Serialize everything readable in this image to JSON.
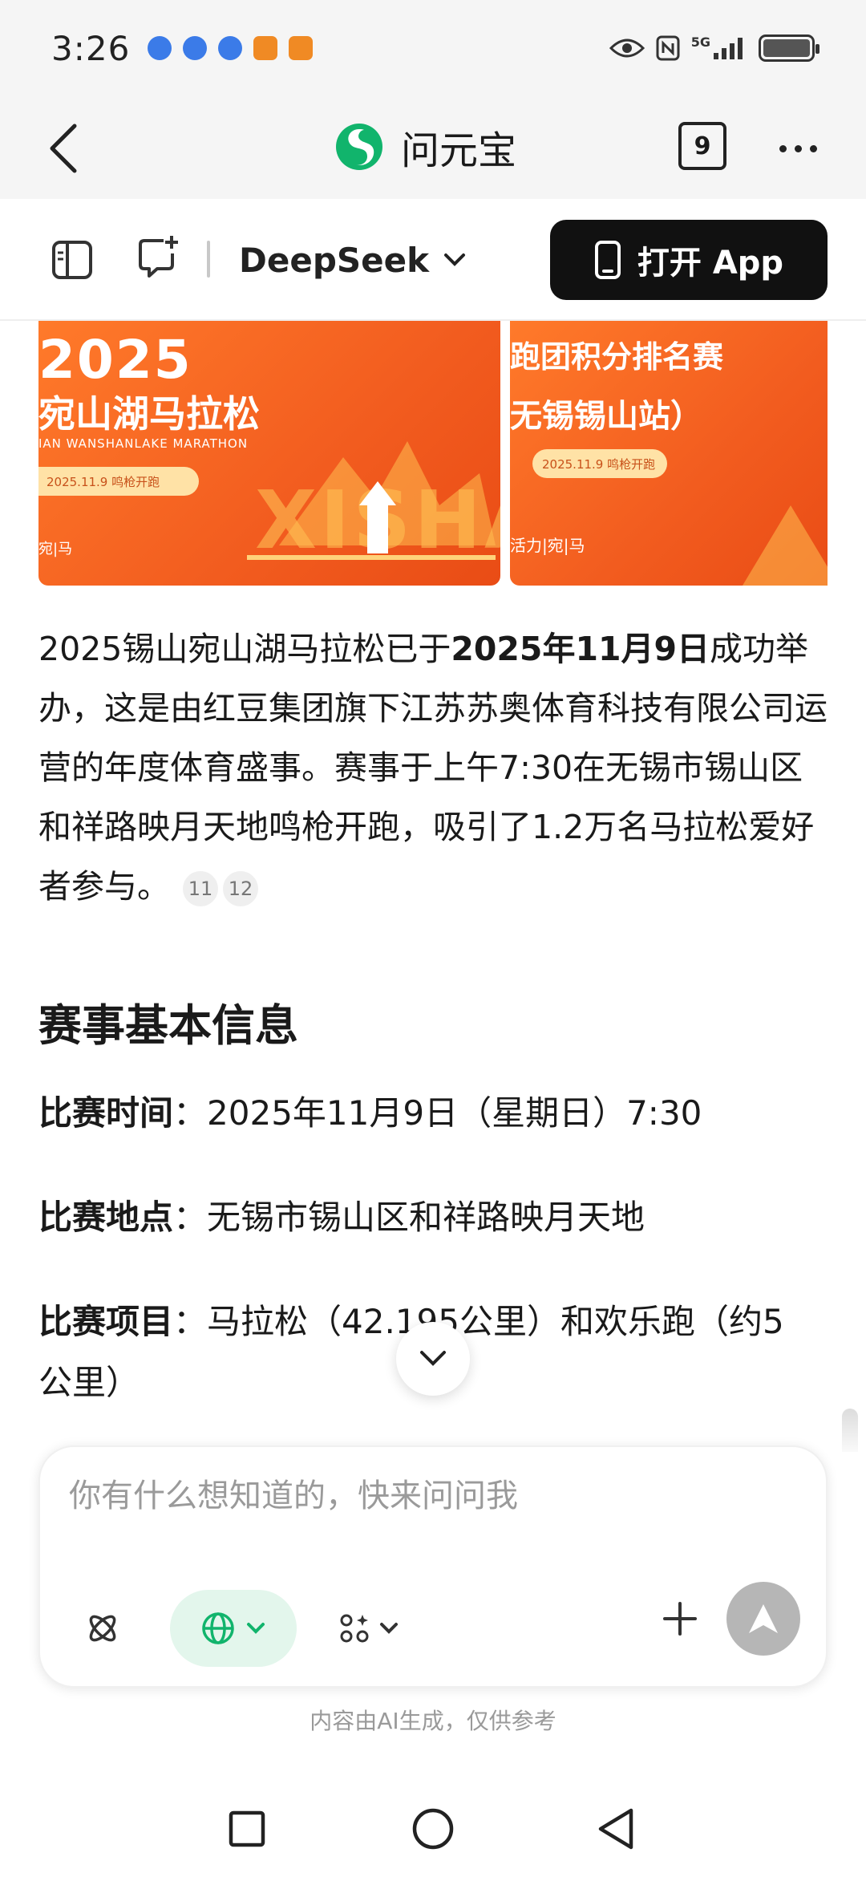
{
  "status_bar": {
    "time": "3:26",
    "network": "5G",
    "icons": [
      "eye-icon",
      "nfc-icon",
      "signal-icon",
      "battery-icon"
    ],
    "notification_colors": [
      "#3b7be8",
      "#3b7be8",
      "#3b7be8",
      "#f08a24",
      "#f08a24"
    ]
  },
  "title_bar": {
    "brand": "问元宝",
    "tab_count": "9",
    "brand_color": "#11b46c"
  },
  "toolbar": {
    "model": "DeepSeek",
    "open_app": "打开 App"
  },
  "banner": {
    "left": {
      "year": "2025",
      "title": "宛山湖马拉松",
      "subtitle_en": "IAN WANSHANLAKE MARATHON",
      "date": "2025.11.9  鸣枪开跑",
      "footer": "宛|马",
      "watermark": "XISHA"
    },
    "right": {
      "line1": "跑团积分排名赛",
      "line2": "无锡锡山站）",
      "date": "2025.11.9  鸣枪开跑",
      "footer": "活力|宛|马"
    }
  },
  "article": {
    "p1_a": "2025锡山宛山湖马拉松已于",
    "p1_bold": "2025年11月9日",
    "p1_b": "成功举办，这是由红豆集团旗下江苏苏奥体育科技有限公司运营的年度体育盛事。赛事于上午7:30在无锡市锡山区和祥路映月天地鸣枪开跑，吸引了1.2万名马拉松爱好者参与。",
    "citations": [
      "11",
      "12"
    ],
    "section_title": "赛事基本信息",
    "info": [
      {
        "key": "比赛时间",
        "sep": "：",
        "value": "2025年11月9日（星期日）7:30"
      },
      {
        "key": "比赛地点",
        "sep": "：",
        "value": "无锡市锡山区和祥路映月天地"
      },
      {
        "key": "比赛项目",
        "sep": "：",
        "value": "马拉松（42.195公里）和欢乐跑（约5"
      }
    ],
    "info_continued": "公里）"
  },
  "input": {
    "placeholder": "你有什么想知道的，快来问问我",
    "accent": "#11b46c"
  },
  "disclaimer": "内容由AI生成，仅供参考"
}
